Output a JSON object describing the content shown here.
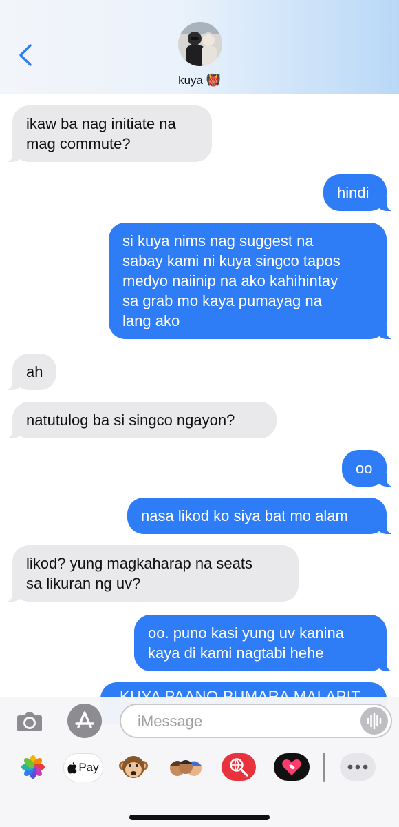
{
  "header": {
    "back_icon": "chevron-left-icon",
    "contact_name": "kuya 👹",
    "avatar": "contact-photo"
  },
  "messages": [
    {
      "side": "in",
      "text": "ikaw ba nag initiate na\nmag commute?"
    },
    {
      "side": "out",
      "text": "hindi"
    },
    {
      "side": "out",
      "text": "si kuya nims nag suggest na\nsabay kami ni kuya singco tapos\nmedyo naiinip na ako kahihintay\nsa grab mo kaya pumayag na\nlang ako"
    },
    {
      "side": "in",
      "text": "ah"
    },
    {
      "side": "in",
      "text": "natutulog ba si singco ngayon?"
    },
    {
      "side": "out",
      "text": "oo"
    },
    {
      "side": "out",
      "text": "nasa likod ko siya bat mo alam"
    },
    {
      "side": "in",
      "text": "likod? yung magkaharap na seats\nsa likuran ng uv?"
    },
    {
      "side": "out",
      "text": "oo. puno kasi yung uv kanina\nkaya di kami nagtabi hehe"
    },
    {
      "side": "out",
      "text": "KUYA PAANO PUMARA MALAPIT"
    }
  ],
  "composer": {
    "placeholder": "iMessage",
    "camera_icon": "camera-icon",
    "apps_icon": "app-store-icon",
    "audio_icon": "waveform-icon"
  },
  "apps": [
    {
      "name": "photos-app-icon",
      "label": ""
    },
    {
      "name": "apple-pay-app-icon",
      "label": "Pay"
    },
    {
      "name": "animoji-app-icon",
      "label": ""
    },
    {
      "name": "memoji-app-icon",
      "label": ""
    },
    {
      "name": "image-search-app-icon",
      "label": ""
    },
    {
      "name": "digital-touch-app-icon",
      "label": ""
    },
    {
      "name": "more-apps-icon",
      "label": ""
    }
  ],
  "colors": {
    "outgoing": "#2f7df6",
    "incoming": "#e9e9eb",
    "accent": "#2f7df6"
  }
}
